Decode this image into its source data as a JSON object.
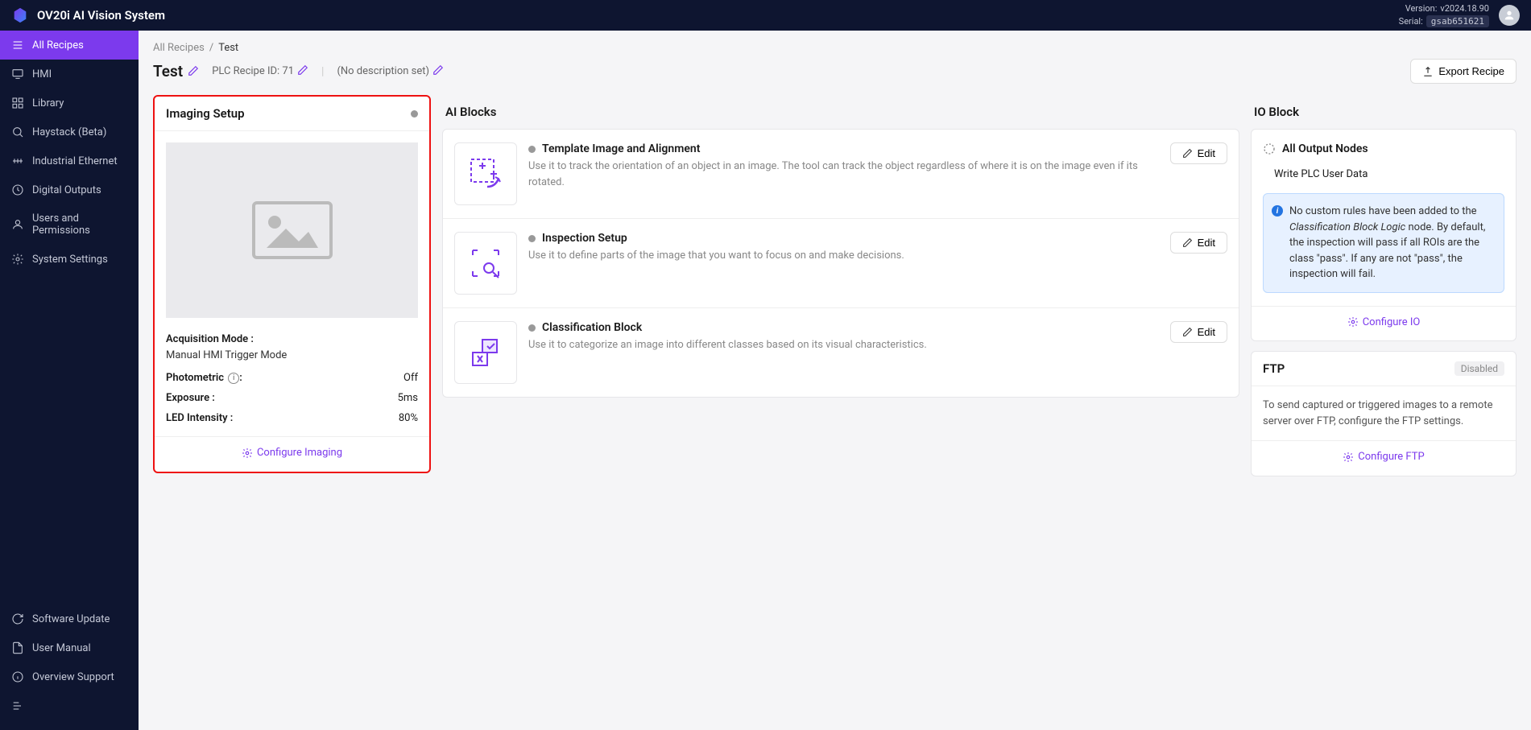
{
  "header": {
    "title": "OV20i AI Vision System",
    "version_label": "Version:",
    "version_value": "v2024.18.90",
    "serial_label": "Serial:",
    "serial_value": "gsab651621"
  },
  "sidebar": {
    "items": [
      "All Recipes",
      "HMI",
      "Library",
      "Haystack (Beta)",
      "Industrial Ethernet",
      "Digital Outputs",
      "Users and Permissions",
      "System Settings"
    ],
    "bottom": [
      "Software Update",
      "User Manual",
      "Overview Support"
    ]
  },
  "breadcrumb": {
    "root": "All Recipes",
    "current": "Test"
  },
  "page": {
    "name": "Test",
    "plc_id_label": "PLC Recipe ID: 71",
    "desc": "(No description set)",
    "export": "Export Recipe"
  },
  "imaging": {
    "title": "Imaging Setup",
    "acq_label": "Acquisition Mode :",
    "acq_value": "Manual HMI Trigger Mode",
    "photo_label": "Photometric",
    "photo_suffix": ":",
    "photo_value": "Off",
    "exp_label": "Exposure :",
    "exp_value": "5ms",
    "led_label": "LED Intensity :",
    "led_value": "80%",
    "configure": "Configure Imaging"
  },
  "ai": {
    "title": "AI Blocks",
    "edit": "Edit",
    "blocks": [
      {
        "name": "Template Image and Alignment",
        "desc": "Use it to track the orientation of an object in an image. The tool can track the object regardless of where it is on the image even if its rotated."
      },
      {
        "name": "Inspection Setup",
        "desc": "Use it to define parts of the image that you want to focus on and make decisions."
      },
      {
        "name": "Classification Block",
        "desc": "Use it to categorize an image into different classes based on its visual characteristics."
      }
    ]
  },
  "io": {
    "title": "IO Block",
    "outputs": "All Output Nodes",
    "write": "Write PLC User Data",
    "info_pre": "No custom rules have been added to the ",
    "info_em": "Classification Block Logic",
    "info_post": " node. By default, the inspection will pass if all ROIs are the class \"pass\". If any are not \"pass\", the inspection will fail.",
    "configure": "Configure IO"
  },
  "ftp": {
    "title": "FTP",
    "badge": "Disabled",
    "desc": "To send captured or triggered images to a remote server over FTP, configure the FTP settings.",
    "configure": "Configure FTP"
  }
}
